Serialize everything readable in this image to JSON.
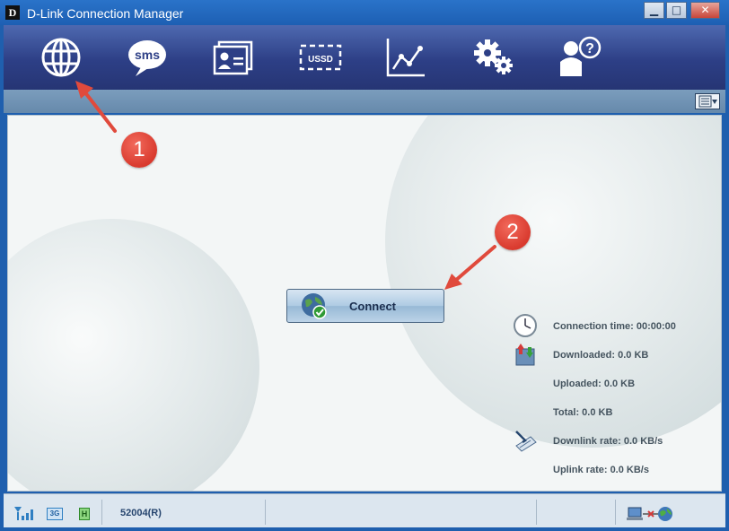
{
  "window": {
    "title": "D-Link Connection Manager",
    "logo_letter": "D",
    "controls": {
      "minimize": "▁",
      "maximize": "□",
      "close": "✕"
    }
  },
  "toolbar": {
    "items": [
      {
        "icon": "globe-icon",
        "label": ""
      },
      {
        "icon": "sms-icon",
        "label": "sms"
      },
      {
        "icon": "contacts-icon",
        "label": ""
      },
      {
        "icon": "ussd-icon",
        "label": "USSD"
      },
      {
        "icon": "statistics-icon",
        "label": ""
      },
      {
        "icon": "settings-icon",
        "label": ""
      },
      {
        "icon": "help-icon",
        "label": ""
      }
    ]
  },
  "main": {
    "connect_label": "Connect",
    "stats": {
      "connection_time": "Connection time:  00:00:00",
      "downloaded": "Downloaded:  0.0 KB",
      "uploaded": "Uploaded:  0.0 KB",
      "total": "Total:  0.0 KB",
      "downlink_rate": "Downlink rate:  0.0 KB/s",
      "uplink_rate": "Uplink rate:  0.0 KB/s"
    },
    "callouts": [
      "1",
      "2"
    ]
  },
  "statusbar": {
    "network_type": "3G",
    "hspa_indicator": "H",
    "operator": "52004(R)"
  },
  "colors": {
    "toolbar": "#2d3f86",
    "badge": "#d93a2e",
    "arrow": "#e04a3c"
  }
}
